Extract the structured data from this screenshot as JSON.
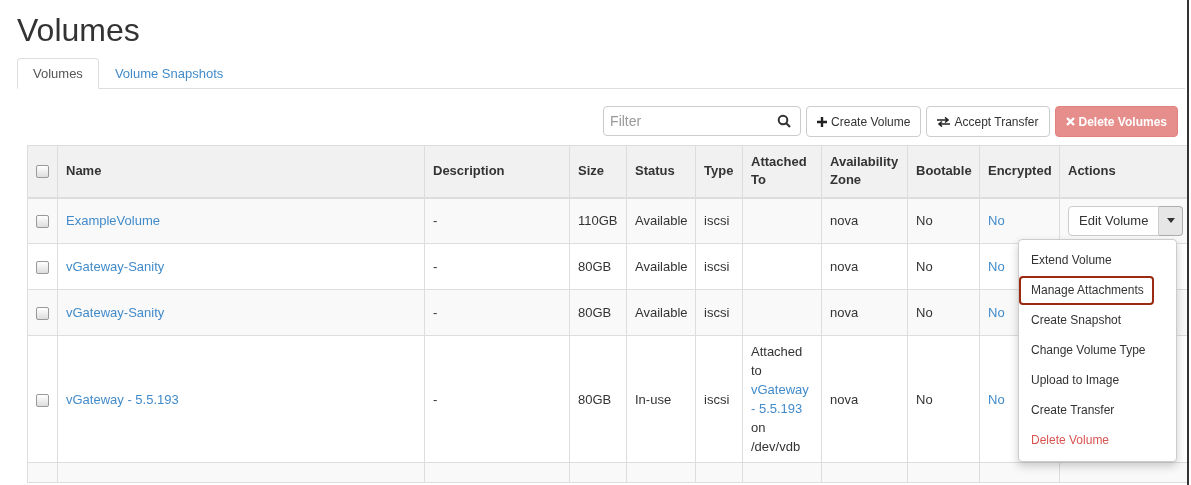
{
  "page_title": "Volumes",
  "tabs": [
    {
      "label": "Volumes",
      "selected": true
    },
    {
      "label": "Volume Snapshots",
      "selected": false
    }
  ],
  "toolbar": {
    "filter": {
      "placeholder": "Filter"
    },
    "buttons": [
      {
        "label": "Create Volume",
        "kind": "create"
      },
      {
        "label": "Accept Transfer",
        "kind": "transfer"
      },
      {
        "label": "Delete Volumes",
        "kind": "danger",
        "disabled": true
      }
    ]
  },
  "table": {
    "select_all": {
      "checked": false
    },
    "columns": [
      "Name",
      "Description",
      "Size",
      "Status",
      "Type",
      "Attached To",
      "Availability Zone",
      "Bootable",
      "Encrypted",
      "Actions"
    ],
    "rows": [
      {
        "checked": false,
        "name": "ExampleVolume",
        "description": "-",
        "size": "110GB",
        "status": "Available",
        "type": "iscsi",
        "zone": "nova",
        "bootable": "No",
        "encrypted": "No",
        "action": {
          "label": "Edit Volume"
        }
      },
      {
        "checked": false,
        "name": "vGateway-Sanity",
        "description": "-",
        "size": "80GB",
        "status": "Available",
        "type": "iscsi",
        "zone": "nova",
        "bootable": "No",
        "encrypted": "No"
      },
      {
        "checked": false,
        "name": "vGateway-Sanity",
        "description": "-",
        "size": "80GB",
        "status": "Available",
        "type": "iscsi",
        "zone": "nova",
        "bootable": "No",
        "encrypted": "No"
      },
      {
        "checked": false,
        "name": "vGateway - 5.5.193",
        "description": "-",
        "size": "80GB",
        "status": "In-use",
        "type": "iscsi",
        "attached_to": {
          "prefix": "Attached to",
          "link": "vGateway - 5.5.193",
          "suffix": "on /dev/vdb"
        },
        "zone": "nova",
        "bootable": "No",
        "encrypted": "No"
      }
    ]
  },
  "action_menu": {
    "items": [
      {
        "label": "Extend Volume",
        "kind": "normal",
        "highlighted": false
      },
      {
        "label": "Manage Attachments",
        "kind": "normal",
        "highlighted": true
      },
      {
        "label": "Create Snapshot",
        "kind": "normal",
        "highlighted": false
      },
      {
        "label": "Change Volume Type",
        "kind": "normal",
        "highlighted": false
      },
      {
        "label": "Upload to Image",
        "kind": "normal",
        "highlighted": false
      },
      {
        "label": "Create Transfer",
        "kind": "normal",
        "highlighted": false
      },
      {
        "label": "Delete Volume",
        "kind": "danger",
        "highlighted": false
      }
    ]
  }
}
